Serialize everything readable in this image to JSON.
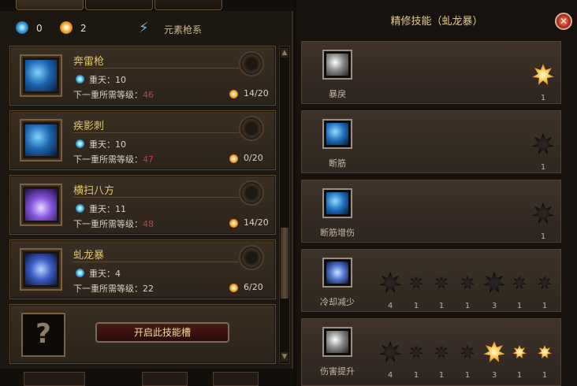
{
  "counters": {
    "blue_points": "0",
    "orange_points": "2",
    "branch_name": "元素枪系"
  },
  "skills": [
    {
      "name": "奔雷枪",
      "rank_label": "重天：",
      "rank": "10",
      "req_prefix": "下一重所需等级：",
      "req": "46",
      "req_red": true,
      "cost": "14/20"
    },
    {
      "name": "疾影刺",
      "rank_label": "重天：",
      "rank": "10",
      "req_prefix": "下一重所需等级：",
      "req": "47",
      "req_red": true,
      "cost": "0/20"
    },
    {
      "name": "横扫八方",
      "rank_label": "重天：",
      "rank": "11",
      "req_prefix": "下一重所需等级：",
      "req": "48",
      "req_red": true,
      "cost": "14/20"
    },
    {
      "name": "虬龙暴",
      "rank_label": "重天：",
      "rank": "4",
      "req_prefix": "下一重所需等级：",
      "req": "22",
      "req_red": false,
      "cost": "6/20"
    }
  ],
  "locked_slot": {
    "icon": "?",
    "button": "开启此技能槽"
  },
  "right_panel": {
    "title": "精修技能（虬龙暴）",
    "perks": [
      {
        "name": "暴戾",
        "stars": [
          {
            "count": "1",
            "lit": true
          }
        ]
      },
      {
        "name": "断筋",
        "stars": [
          {
            "count": "1",
            "lit": false
          }
        ]
      },
      {
        "name": "断筋增伤",
        "stars": [
          {
            "count": "1",
            "lit": false
          }
        ]
      },
      {
        "name": "冷却减少",
        "stars": [
          {
            "count": "4",
            "lit": false,
            "big": true
          },
          {
            "count": "1",
            "lit": false
          },
          {
            "count": "1",
            "lit": false
          },
          {
            "count": "1",
            "lit": false
          },
          {
            "count": "3",
            "lit": false,
            "big": true
          },
          {
            "count": "1",
            "lit": false
          },
          {
            "count": "1",
            "lit": false
          }
        ]
      },
      {
        "name": "伤害提升",
        "stars": [
          {
            "count": "4",
            "lit": false,
            "big": true
          },
          {
            "count": "1",
            "lit": false
          },
          {
            "count": "1",
            "lit": false
          },
          {
            "count": "1",
            "lit": false
          },
          {
            "count": "3",
            "lit": true,
            "big": true
          },
          {
            "count": "1",
            "lit": true
          },
          {
            "count": "1",
            "lit": true
          }
        ]
      }
    ]
  }
}
